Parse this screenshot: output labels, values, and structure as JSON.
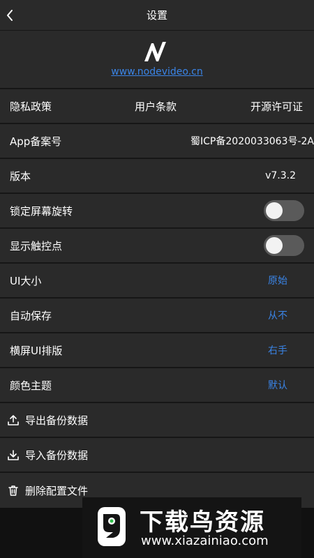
{
  "header": {
    "title": "设置",
    "back_icon": "chevron-left-icon"
  },
  "brand": {
    "site": "www.nodevideo.cn",
    "logo_icon": "nodevideo-logo-icon"
  },
  "links": {
    "privacy": "隐私政策",
    "terms": "用户条款",
    "license": "开源许可证"
  },
  "icp": {
    "label": "App备案号",
    "value": "蜀ICP备2020033063号-2A"
  },
  "version": {
    "label": "版本",
    "value": "v7.3.2"
  },
  "toggles": [
    {
      "label": "锁定屏幕旋转",
      "on": false
    },
    {
      "label": "显示触控点",
      "on": false
    }
  ],
  "options": [
    {
      "label": "UI大小",
      "value": "原始"
    },
    {
      "label": "自动保存",
      "value": "从不"
    },
    {
      "label": "横屏UI排版",
      "value": "右手"
    },
    {
      "label": "颜色主题",
      "value": "默认"
    }
  ],
  "actions": [
    {
      "label": "导出备份数据",
      "icon": "upload-icon"
    },
    {
      "label": "导入备份数据",
      "icon": "download-icon"
    },
    {
      "label": "删除配置文件",
      "icon": "trash-icon"
    }
  ],
  "watermark": {
    "title": "下载鸟资源",
    "url": "www.xiazainiao.com"
  },
  "colors": {
    "background": "#1f1f1f",
    "row": "#2a2a2a",
    "accent": "#3a84e6",
    "toggle_track": "#5a5a5a"
  }
}
